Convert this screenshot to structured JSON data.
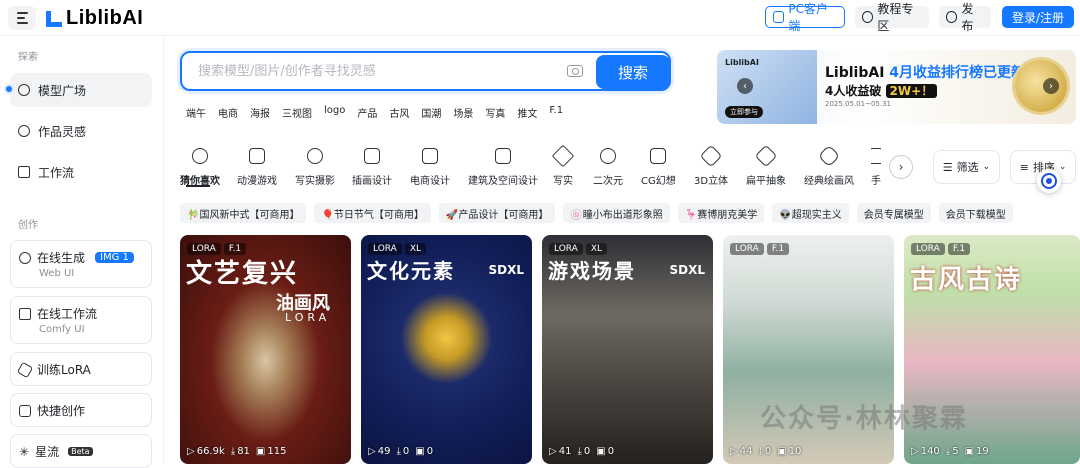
{
  "header": {
    "logo_text": "LiblibAI",
    "pc_client": "PC客户端",
    "tutorial": "教程专区",
    "publish": "发布",
    "login": "登录/注册"
  },
  "sidebar": {
    "section_explore": "探索",
    "section_create": "创作",
    "nav": [
      {
        "label": "模型广场",
        "icon": "model-square-icon",
        "active": true
      },
      {
        "label": "作品灵感",
        "icon": "bulb-icon",
        "active": false
      },
      {
        "label": "工作流",
        "icon": "workflow-icon",
        "active": false
      }
    ],
    "cards": [
      {
        "label": "在线生成",
        "badge": "IMG 1",
        "sub": "Web UI",
        "icon": "palette-icon"
      },
      {
        "label": "在线工作流",
        "sub": "Comfy UI",
        "icon": "comfy-icon"
      },
      {
        "label": "训练LoRA",
        "icon": "cube-icon"
      },
      {
        "label": "快捷创作",
        "icon": "box-icon"
      },
      {
        "label": "星流",
        "beta": "Beta",
        "icon": "star-flow-icon"
      }
    ]
  },
  "search": {
    "placeholder": "搜索模型/图片/创作者寻找灵感",
    "button": "搜索",
    "hotwords": [
      "端午",
      "电商",
      "海报",
      "三视图",
      "logo",
      "产品",
      "古风",
      "国潮",
      "场景",
      "写真",
      "推文",
      "F.1"
    ]
  },
  "banner": {
    "logo": "LiblibAI",
    "title_prefix": "LiblibAI ",
    "title_highlight": "4月收益排行榜已更新",
    "line2": "4人收益破",
    "line2_badge": "2W+！",
    "small": "2025.05.01~05.31",
    "button": "立即参与"
  },
  "categories": [
    {
      "label": "猜你喜欢",
      "active": true
    },
    {
      "label": "动漫游戏"
    },
    {
      "label": "写实摄影"
    },
    {
      "label": "插画设计"
    },
    {
      "label": "电商设计"
    },
    {
      "label": "建筑及空间设计"
    },
    {
      "label": "写实"
    },
    {
      "label": "二次元"
    },
    {
      "label": "CG幻想"
    },
    {
      "label": "3D立体"
    },
    {
      "label": "扁平抽象"
    },
    {
      "label": "经典绘画风"
    },
    {
      "label": "手"
    }
  ],
  "controls": {
    "filter": "筛选",
    "sort": "排序"
  },
  "tags": [
    "🎋国风新中式【可商用】",
    "🎈节日节气【可商用】",
    "🚀产品设计【可商用】",
    "🍥瞳小布出道形象照",
    "🦩赛博朋克美学",
    "👽超现实主义",
    "会员专属模型",
    "会员下载模型"
  ],
  "cards": [
    {
      "types": [
        "LORA",
        "F.1"
      ],
      "title": "文艺复兴",
      "sub": "油画风",
      "lora": "LORA",
      "sdx": "",
      "stats": [
        "66.9k",
        "81",
        "115"
      ]
    },
    {
      "types": [
        "LORA",
        "XL"
      ],
      "title": "文化元素",
      "sub": "",
      "lora": "",
      "sdx": "SDXL",
      "stats": [
        "49",
        "0",
        "0"
      ]
    },
    {
      "types": [
        "LORA",
        "XL"
      ],
      "title": "游戏场景",
      "sub": "",
      "lora": "",
      "sdx": "SDXL",
      "stats": [
        "41",
        "0",
        "0"
      ]
    },
    {
      "types": [
        "LORA",
        "F.1"
      ],
      "title": "",
      "sub": "",
      "lora": "",
      "sdx": "",
      "stats": [
        "44",
        "0",
        "10"
      ]
    },
    {
      "types": [
        "LORA",
        "F.1"
      ],
      "title": "古风古诗",
      "sub": "",
      "lora": "",
      "sdx": "",
      "stats": [
        "140",
        "5",
        "19"
      ]
    }
  ],
  "watermark": "公众号·林林聚霖"
}
